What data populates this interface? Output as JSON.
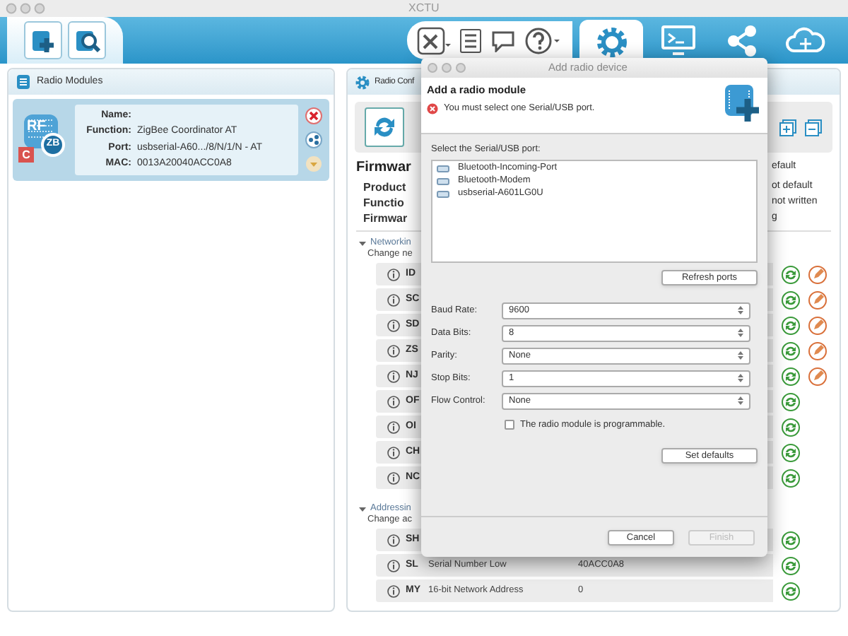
{
  "window": {
    "title": "XCTU"
  },
  "toolbar": {
    "tabs": [
      {
        "kind": "configuration",
        "selected": true
      },
      {
        "kind": "consoles",
        "selected": false
      },
      {
        "kind": "network",
        "selected": false
      },
      {
        "kind": "cloud",
        "selected": false
      }
    ]
  },
  "radio_modules": {
    "title": "Radio Modules",
    "modules": [
      {
        "selected": true,
        "badges": [
          "RF",
          "ZB",
          "C"
        ],
        "fields": [
          {
            "label": "Name:"
          },
          {
            "label": "Function:",
            "value": "ZigBee Coordinator AT"
          },
          {
            "label": "Port:",
            "value": "usbserial-A60.../8/N/1/N - AT"
          },
          {
            "label": "MAC:",
            "value": "0013A20040ACC0A8"
          }
        ]
      }
    ]
  },
  "radio_configuration": {
    "title": "Radio Conf",
    "firmware": {
      "title": "Firmwar",
      "title_value": "efault",
      "rows": [
        {
          "label": "Product",
          "value": "ot default"
        },
        {
          "label": "Functio",
          "value": "not written"
        },
        {
          "label": "Firmwar",
          "value": "g"
        }
      ]
    },
    "sections": [
      {
        "title": "Networkin",
        "subtitle": "Change ne",
        "expanded": true,
        "params": [
          {
            "code": "ID",
            "writable": true
          },
          {
            "code": "SC",
            "writable": true
          },
          {
            "code": "SD",
            "writable": true
          },
          {
            "code": "ZS",
            "writable": true
          },
          {
            "code": "NJ",
            "writable": true
          },
          {
            "code": "OF",
            "writable": false
          },
          {
            "code": "OI",
            "writable": false
          },
          {
            "code": "CH",
            "writable": false
          },
          {
            "code": "NC",
            "writable": false
          }
        ]
      },
      {
        "title": "Addressin",
        "subtitle": "Change ac",
        "expanded": true,
        "params": [
          {
            "code": "SH",
            "writable": false
          },
          {
            "code": "SL",
            "name": "Serial Number Low",
            "value": "40ACC0A8",
            "writable": false
          },
          {
            "code": "MY",
            "name": "16-bit Network Address",
            "value": "0",
            "writable": false
          }
        ]
      }
    ]
  },
  "dialog": {
    "title": "Add radio device",
    "heading": "Add a radio module",
    "error": "You must select one Serial/USB port.",
    "ports_label": "Select the Serial/USB port:",
    "ports": [
      {
        "name": "Bluetooth-Incoming-Port",
        "selected": false
      },
      {
        "name": "Bluetooth-Modem",
        "selected": false
      },
      {
        "name": "usbserial-A601LG0U",
        "selected": false
      }
    ],
    "refresh_button": "Refresh ports",
    "settings": [
      {
        "label": "Baud Rate:",
        "value": "9600"
      },
      {
        "label": "Data Bits:",
        "value": "8"
      },
      {
        "label": "Parity:",
        "value": "None"
      },
      {
        "label": "Stop Bits:",
        "value": "1"
      },
      {
        "label": "Flow Control:",
        "value": "None"
      }
    ],
    "programmable": {
      "label": "The radio module is programmable.",
      "checked": false
    },
    "defaults_button": "Set defaults",
    "buttons": [
      {
        "label": "Cancel",
        "disabled": false
      },
      {
        "label": "Finish",
        "disabled": true
      }
    ]
  }
}
